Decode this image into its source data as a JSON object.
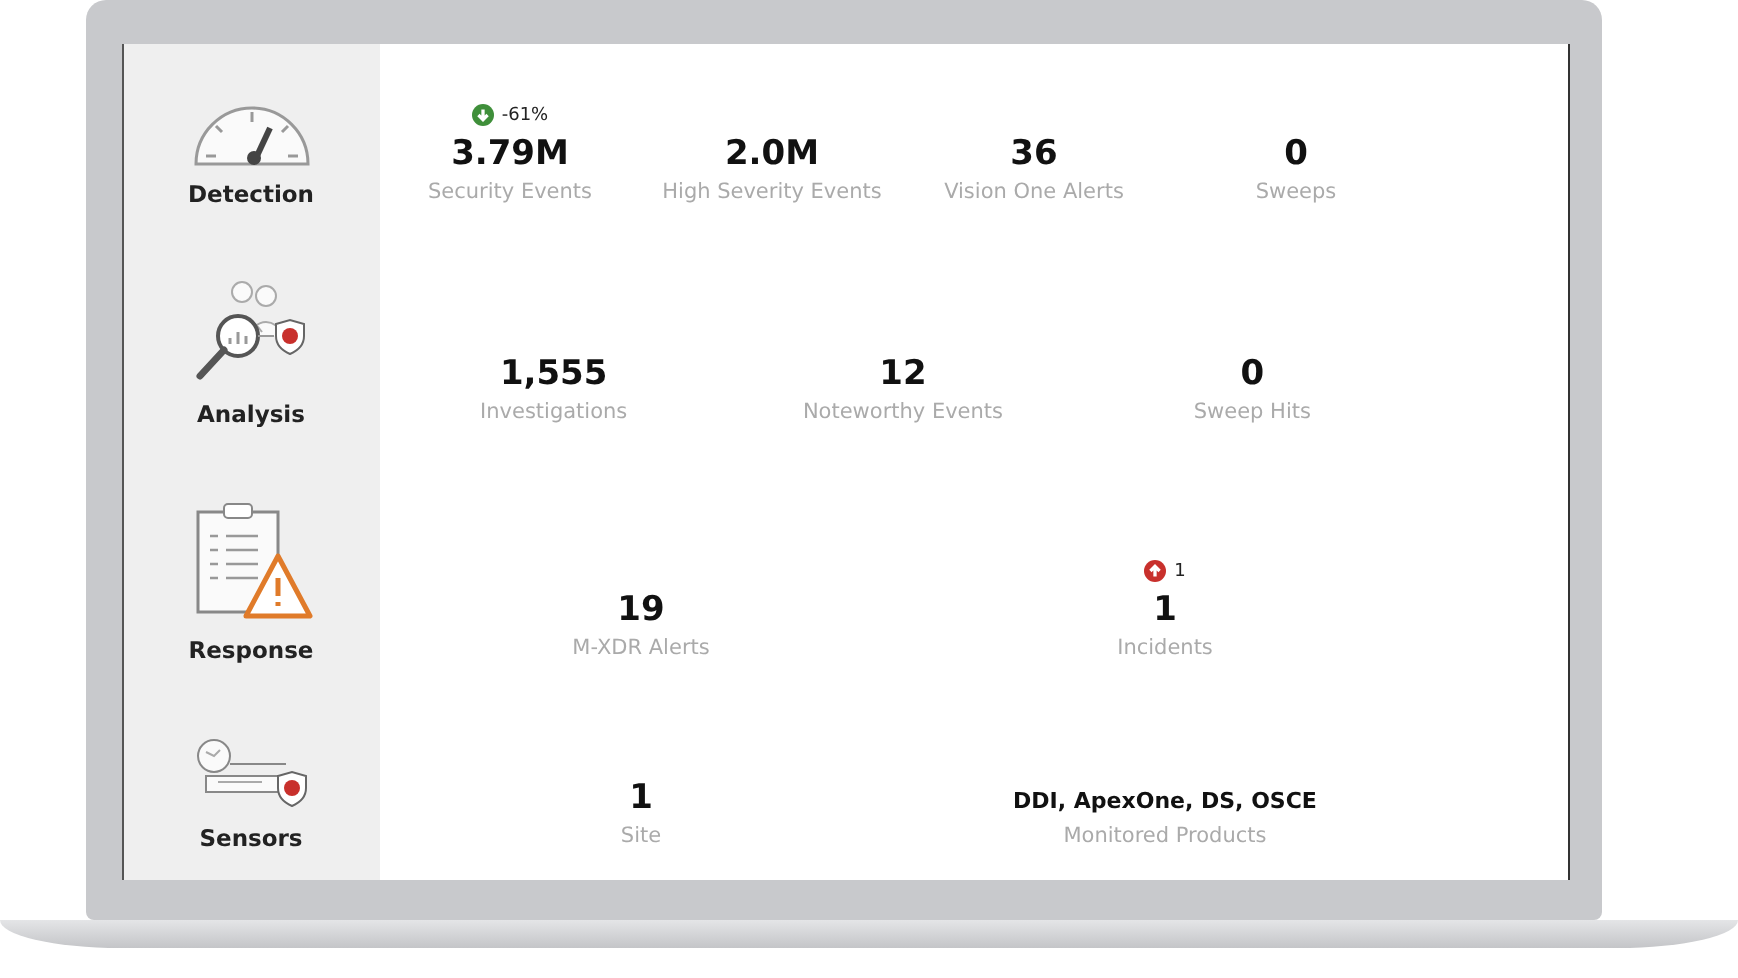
{
  "sections": [
    {
      "label": "Detection",
      "stats": [
        {
          "value": "3.79M",
          "label": "Security Events",
          "change": {
            "kind": "decrease",
            "text": "-61%"
          }
        },
        {
          "value": "2.0M",
          "label": "High Severity Events"
        },
        {
          "value": "36",
          "label": "Vision One Alerts"
        },
        {
          "value": "0",
          "label": "Sweeps"
        }
      ]
    },
    {
      "label": "Analysis",
      "stats": [
        {
          "value": "1,555",
          "label": "Investigations"
        },
        {
          "value": "12",
          "label": "Noteworthy Events"
        },
        {
          "value": "0",
          "label": "Sweep Hits"
        }
      ]
    },
    {
      "label": "Response",
      "stats": [
        {
          "value": "19",
          "label": "M-XDR Alerts"
        },
        {
          "value": "1",
          "label": "Incidents",
          "change": {
            "kind": "increase",
            "text": "1"
          }
        }
      ]
    },
    {
      "label": "Sensors",
      "stats": [
        {
          "value": "1",
          "label": "Site"
        },
        {
          "value": "DDI, ApexOne, DS, OSCE",
          "label": "Monitored Products",
          "kind": "text"
        }
      ]
    }
  ]
}
